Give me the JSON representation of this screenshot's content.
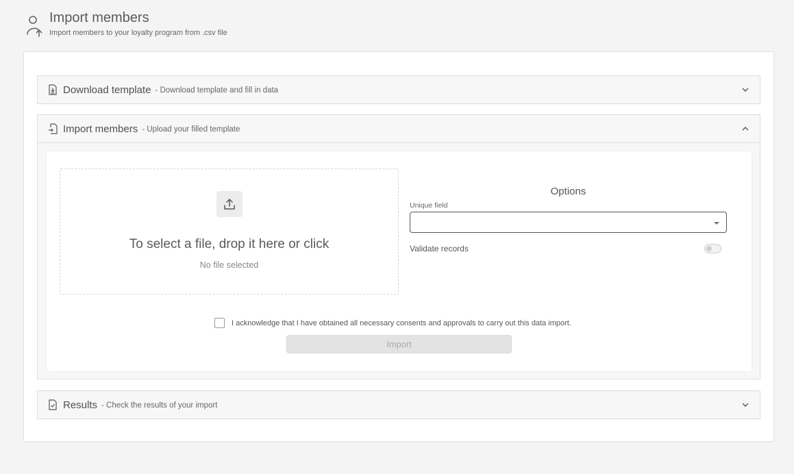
{
  "header": {
    "icon": "user-upload-icon",
    "title": "Import members",
    "subtitle": "Import members to your loyalty program from .csv file"
  },
  "panels": {
    "download": {
      "icon": "file-download-icon",
      "title": "Download template",
      "description": "- Download template and fill in data",
      "expanded": false
    },
    "import": {
      "icon": "file-import-icon",
      "title": "Import members",
      "description": "- Upload your filled template",
      "expanded": true,
      "dropzone": {
        "icon": "upload-icon",
        "text": "To select a file, drop it here or click",
        "status": "No file selected"
      },
      "options": {
        "title": "Options",
        "unique_field_label": "Unique field",
        "unique_field_value": "",
        "validate_label": "Validate records",
        "validate_enabled": false
      },
      "consent_text": "I acknowledge that I have obtained all necessary consents and approvals to carry out this data import.",
      "consent_checked": false,
      "import_button": "Import",
      "import_enabled": false
    },
    "results": {
      "icon": "file-check-icon",
      "title": "Results",
      "description": "- Check the results of your import",
      "expanded": false
    }
  }
}
